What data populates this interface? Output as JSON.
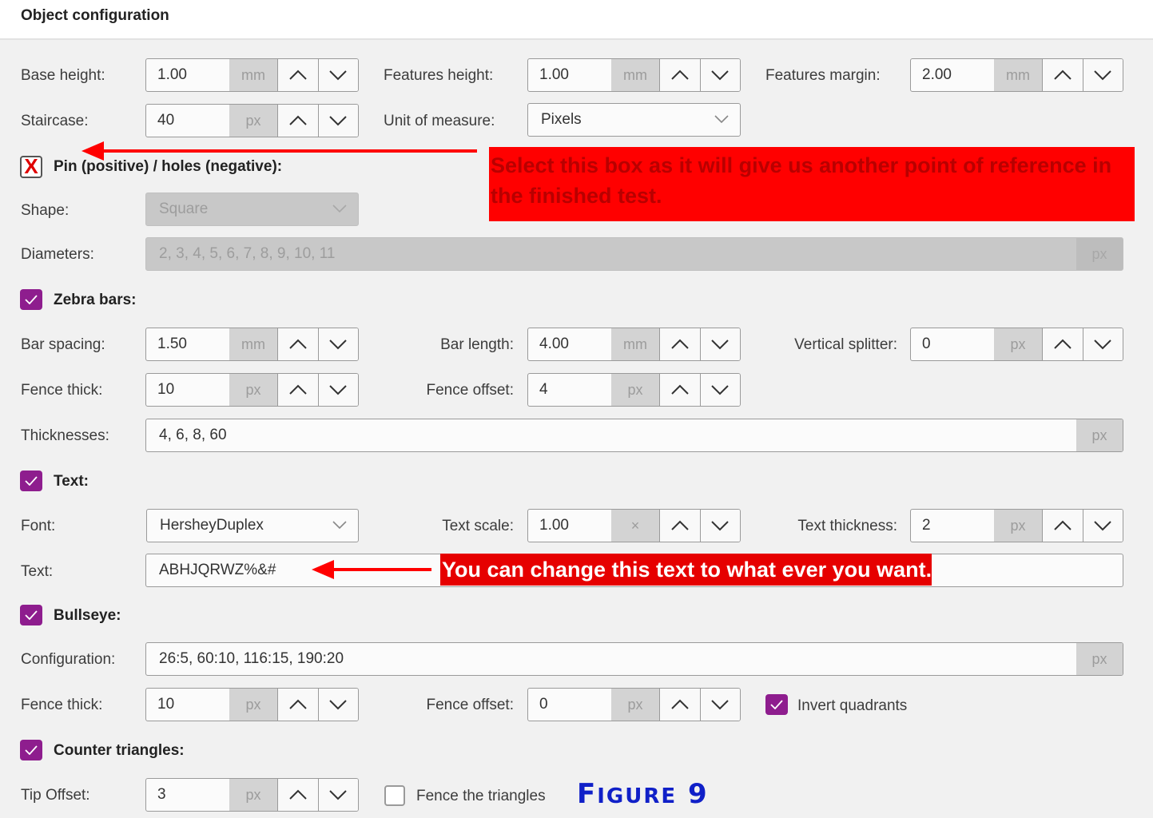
{
  "header": {
    "title": "Object configuration"
  },
  "row1": {
    "base_height": {
      "label": "Base height:",
      "value": "1.00",
      "unit": "mm"
    },
    "features_height": {
      "label": "Features height:",
      "value": "1.00",
      "unit": "mm"
    },
    "features_margin": {
      "label": "Features margin:",
      "value": "2.00",
      "unit": "mm"
    }
  },
  "row2": {
    "staircase": {
      "label": "Staircase:",
      "value": "40",
      "unit": "px"
    },
    "unit_of_measure": {
      "label": "Unit of measure:",
      "value": "Pixels"
    }
  },
  "pins": {
    "label": "Pin (positive) / holes (negative):",
    "checkbox_mark": "X",
    "shape": {
      "label": "Shape:",
      "value": "Square"
    },
    "diameters": {
      "label": "Diameters:",
      "value": "2, 3, 4, 5, 6, 7, 8, 9, 10, 11",
      "unit": "px"
    },
    "callout": "Select this box as it will give us another point of reference in the finished test."
  },
  "zebra": {
    "label": "Zebra bars:",
    "bar_spacing": {
      "label": "Bar spacing:",
      "value": "1.50",
      "unit": "mm"
    },
    "bar_length": {
      "label": "Bar length:",
      "value": "4.00",
      "unit": "mm"
    },
    "vertical_splitter": {
      "label": "Vertical splitter:",
      "value": "0",
      "unit": "px"
    },
    "fence_thick": {
      "label": "Fence thick:",
      "value": "10",
      "unit": "px"
    },
    "fence_offset": {
      "label": "Fence offset:",
      "value": "4",
      "unit": "px"
    },
    "thicknesses": {
      "label": "Thicknesses:",
      "value": "4, 6, 8, 60",
      "unit": "px"
    }
  },
  "text": {
    "label": "Text:",
    "font": {
      "label": "Font:",
      "value": "HersheyDuplex"
    },
    "text_scale": {
      "label": "Text scale:",
      "value": "1.00",
      "unit": "×"
    },
    "text_thickness": {
      "label": "Text thickness:",
      "value": "2",
      "unit": "px"
    },
    "text_field": {
      "label": "Text:",
      "value": "ABHJQRWZ%&#"
    },
    "callout": "You can change this text to what ever you want."
  },
  "bullseye": {
    "label": "Bullseye:",
    "configuration": {
      "label": "Configuration:",
      "value": "26:5, 60:10, 116:15, 190:20",
      "unit": "px"
    },
    "fence_thick": {
      "label": "Fence thick:",
      "value": "10",
      "unit": "px"
    },
    "fence_offset": {
      "label": "Fence offset:",
      "value": "0",
      "unit": "px"
    },
    "invert_quadrants": {
      "label": "Invert quadrants"
    }
  },
  "counter_triangles": {
    "label": "Counter triangles:",
    "tip_offset": {
      "label": "Tip Offset:",
      "value": "3",
      "unit": "px"
    },
    "fence_triangles": {
      "label": "Fence the triangles"
    }
  },
  "figure": {
    "prefix": "F",
    "rest": "IGURE",
    "number": "9"
  },
  "colors": {
    "accent": "#8e1d8e",
    "annotation_red": "#e60000",
    "figure_blue": "#1020c8"
  }
}
